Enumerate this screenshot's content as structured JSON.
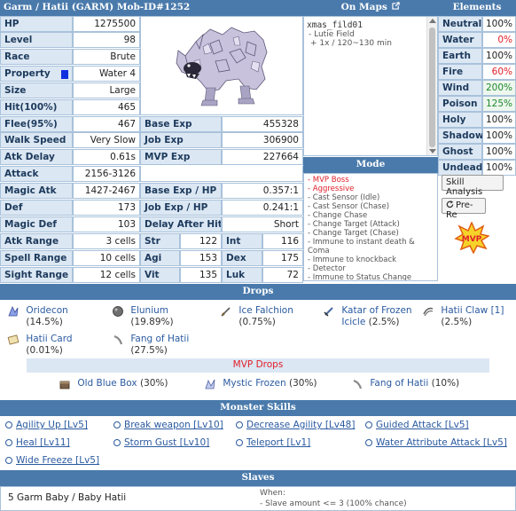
{
  "header": {
    "title": "Garm / Hatii  (GARM)  Mob-ID#1252",
    "maps": "On Maps",
    "elements": "Elements"
  },
  "stats": {
    "hp": {
      "label": "HP",
      "value": "1275500"
    },
    "level": {
      "label": "Level",
      "value": "98"
    },
    "race": {
      "label": "Race",
      "value": "Brute"
    },
    "property": {
      "label": "Property",
      "value": "Water 4"
    },
    "size": {
      "label": "Size",
      "value": "Large"
    },
    "hit": {
      "label": "Hit(100%)",
      "value": "465"
    },
    "flee": {
      "label": "Flee(95%)",
      "value": "467"
    },
    "base_exp": {
      "label": "Base Exp",
      "value": "455328"
    },
    "walk_speed": {
      "label": "Walk Speed",
      "value": "Very Slow"
    },
    "job_exp": {
      "label": "Job Exp",
      "value": "306900"
    },
    "atk_delay": {
      "label": "Atk Delay",
      "value": "0.61s"
    },
    "mvp_exp": {
      "label": "MVP Exp",
      "value": "227664"
    },
    "attack": {
      "label": "Attack",
      "value": "2156-3126"
    },
    "magic_atk": {
      "label": "Magic Atk",
      "value": "1427-2467"
    },
    "base_exp_hp": {
      "label": "Base Exp / HP",
      "value": "0.357:1"
    },
    "def": {
      "label": "Def",
      "value": "173"
    },
    "job_exp_hp": {
      "label": "Job Exp / HP",
      "value": "0.241:1"
    },
    "magic_def": {
      "label": "Magic Def",
      "value": "103"
    },
    "delay_after_hit": {
      "label": "Delay After Hit",
      "value": "Short"
    },
    "atk_range": {
      "label": "Atk Range",
      "value": "3 cells"
    },
    "str": {
      "label": "Str",
      "value": "122"
    },
    "int": {
      "label": "Int",
      "value": "116"
    },
    "spell_range": {
      "label": "Spell Range",
      "value": "10 cells"
    },
    "agi": {
      "label": "Agi",
      "value": "153"
    },
    "dex": {
      "label": "Dex",
      "value": "175"
    },
    "sight_range": {
      "label": "Sight Range",
      "value": "12 cells"
    },
    "vit": {
      "label": "Vit",
      "value": "135"
    },
    "luk": {
      "label": "Luk",
      "value": "72"
    }
  },
  "maps": {
    "name": "xmas_fild01",
    "subtitle": "- Lutie Field",
    "spawn": "+ 1x / 120~130 min"
  },
  "mode": {
    "title": "Mode",
    "items": [
      {
        "text": "- MVP Boss",
        "red": true
      },
      {
        "text": "- Aggressive",
        "red": true
      },
      {
        "text": "- Cast Sensor (Idle)",
        "red": false
      },
      {
        "text": "- Cast Sensor (Chase)",
        "red": false
      },
      {
        "text": "- Change Chase",
        "red": false
      },
      {
        "text": "- Change Target (Attack)",
        "red": false
      },
      {
        "text": "- Change Target (Chase)",
        "red": false
      },
      {
        "text": "- Immune to instant death &",
        "red": false
      },
      {
        "text": "Coma",
        "red": false
      },
      {
        "text": "- Immune to knockback",
        "red": false
      },
      {
        "text": "- Detector",
        "red": false
      },
      {
        "text": "- Immune to Status Change",
        "red": false
      }
    ]
  },
  "elements": [
    {
      "name": "Neutral",
      "value": "100%",
      "color": "#222"
    },
    {
      "name": "Water",
      "value": "0%",
      "color": "#e0202a"
    },
    {
      "name": "Earth",
      "value": "100%",
      "color": "#222"
    },
    {
      "name": "Fire",
      "value": "60%",
      "color": "#e0202a"
    },
    {
      "name": "Wind",
      "value": "200%",
      "color": "#1e8a2e"
    },
    {
      "name": "Poison",
      "value": "125%",
      "color": "#1e8a2e"
    },
    {
      "name": "Holy",
      "value": "100%",
      "color": "#222"
    },
    {
      "name": "Shadow",
      "value": "100%",
      "color": "#222"
    },
    {
      "name": "Ghost",
      "value": "100%",
      "color": "#222"
    },
    {
      "name": "Undead",
      "value": "100%",
      "color": "#222"
    }
  ],
  "buttons": {
    "skill_analysis": "Skill Analysis",
    "pre_re": "Pre-Re"
  },
  "mvp_badge": "MVP",
  "drops": {
    "title": "Drops",
    "items": [
      {
        "name": "Oridecon",
        "rate": "(14.5%)"
      },
      {
        "name": "Elunium",
        "rate": "(19.89%)"
      },
      {
        "name": "Ice Falchion",
        "rate": "(0.75%)"
      },
      {
        "name": "Katar of Frozen",
        "name2": "Icicle",
        "rate": "(2.5%)"
      },
      {
        "name": "Hatii Claw",
        "slots": "[1]",
        "rate": "(2.5%)"
      },
      {
        "name": "Hatii Card",
        "rate": "(0.01%)"
      },
      {
        "name": "Fang of Hatii",
        "rate": "(27.5%)"
      }
    ],
    "mvp_title": "MVP Drops",
    "mvp_items": [
      {
        "name": "Old Blue Box",
        "rate": "(30%)"
      },
      {
        "name": "Mystic Frozen",
        "rate": "(30%)"
      },
      {
        "name": "Fang of Hatii",
        "rate": "(10%)"
      }
    ]
  },
  "skills": {
    "title": "Monster Skills",
    "items": [
      "Agility Up [Lv5]",
      "Break weapon [Lv10]",
      "Decrease Agility [Lv48]",
      "Guided Attack [Lv5]",
      "Heal [Lv11]",
      "Storm Gust [Lv10]",
      "Teleport [Lv1]",
      "Water Attribute Attack [Lv5]",
      "Wide Freeze [Lv5]"
    ]
  },
  "slaves": {
    "title": "Slaves",
    "entry": "5 Garm Baby / Baby Hatii",
    "when_label": "When:",
    "condition": "- Slave amount <= 3 (100% chance)"
  }
}
